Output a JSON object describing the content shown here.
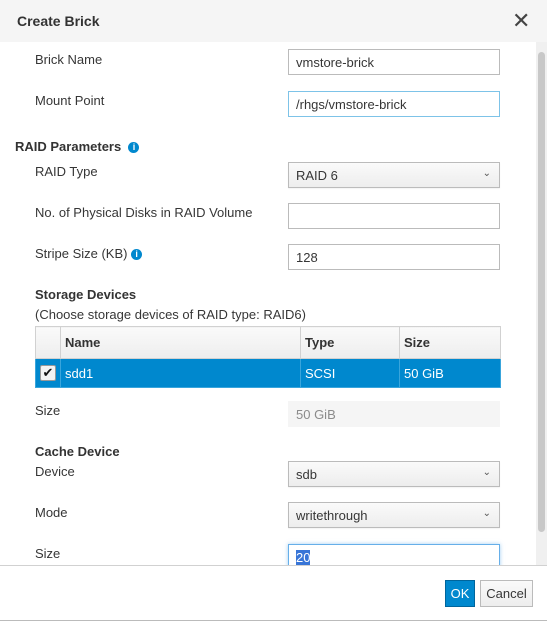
{
  "dialog": {
    "title": "Create Brick",
    "close_icon": "close-icon"
  },
  "form": {
    "brick_name": {
      "label": "Brick Name",
      "value": "vmstore-brick"
    },
    "mount_point": {
      "label": "Mount Point",
      "value": "/rhgs/vmstore-brick"
    },
    "raid_section": "RAID Parameters",
    "raid_type": {
      "label": "RAID Type",
      "value": "RAID 6"
    },
    "physical_disks": {
      "label": "No. of Physical Disks in RAID Volume",
      "value": ""
    },
    "stripe_size": {
      "label": "Stripe Size (KB)",
      "value": "128"
    },
    "storage_devices": {
      "title": "Storage Devices",
      "hint": "(Choose storage devices of RAID type: RAID6)",
      "columns": [
        "Name",
        "Type",
        "Size"
      ],
      "rows": [
        {
          "checked": true,
          "name": "sdd1",
          "type": "SCSI",
          "size": "50 GiB"
        }
      ]
    },
    "size": {
      "label": "Size",
      "value": "50 GiB"
    },
    "cache_section": "Cache Device",
    "cache_device": {
      "label": "Device",
      "value": "sdb"
    },
    "cache_mode": {
      "label": "Mode",
      "value": "writethrough"
    },
    "cache_size": {
      "label": "Size",
      "value": "20"
    }
  },
  "footer": {
    "ok": "OK",
    "cancel": "Cancel"
  },
  "colors": {
    "primary": "#0088ce",
    "selected_row": "#0088ce"
  }
}
